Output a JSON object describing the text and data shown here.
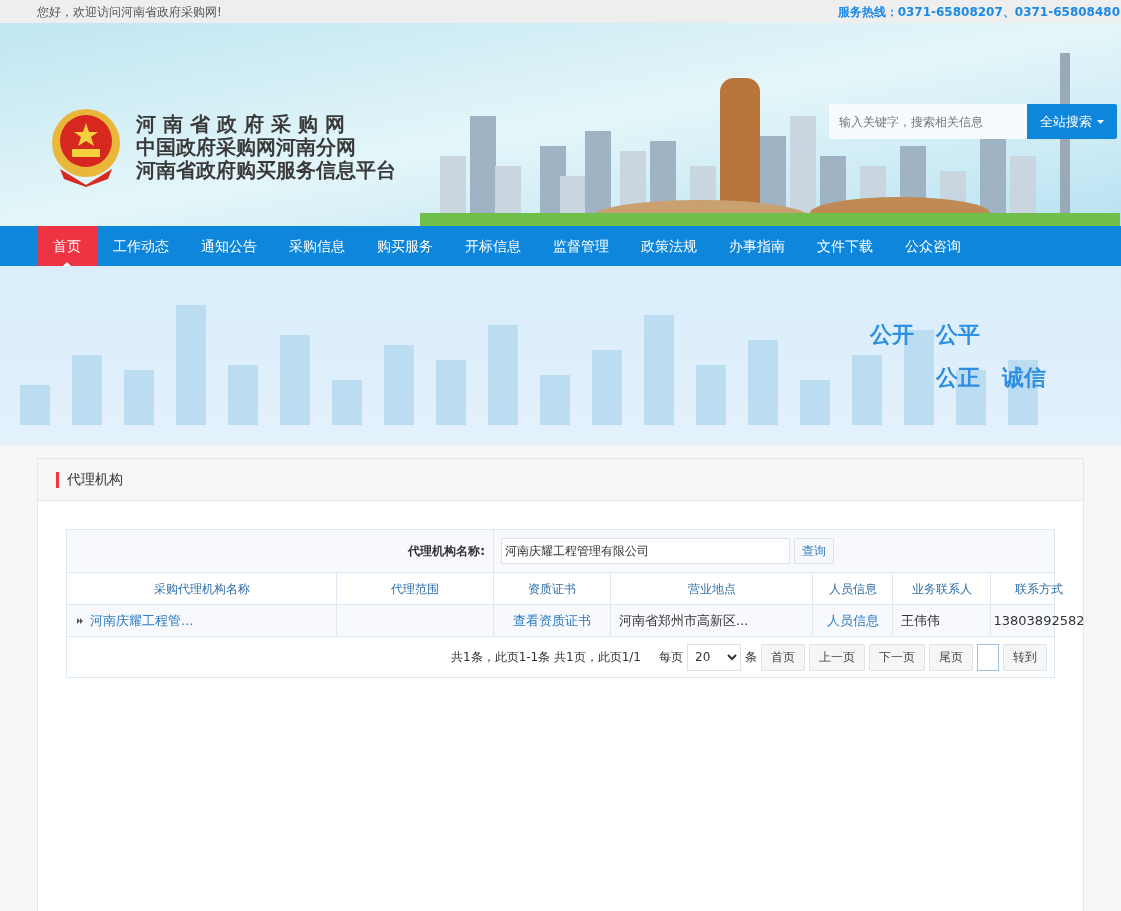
{
  "top_bar": {
    "greeting": "您好，欢迎访问河南省政府采购网!",
    "hotline": "服务热线：0371-65808207、0371-65808480"
  },
  "header": {
    "title_lines": [
      "河 南 省 政 府 采 购 网",
      "中国政府采购网河南分网",
      "河南省政府购买服务信息平台"
    ],
    "search": {
      "placeholder": "输入关键字，搜索相关信息",
      "button": "全站搜索"
    }
  },
  "nav": [
    {
      "label": "首页",
      "selected": true
    },
    {
      "label": "工作动态",
      "selected": false
    },
    {
      "label": "通知公告",
      "selected": false
    },
    {
      "label": "采购信息",
      "selected": false
    },
    {
      "label": "购买服务",
      "selected": false
    },
    {
      "label": "开标信息",
      "selected": false
    },
    {
      "label": "监督管理",
      "selected": false
    },
    {
      "label": "政策法规",
      "selected": false
    },
    {
      "label": "办事指南",
      "selected": false
    },
    {
      "label": "文件下载",
      "selected": false
    },
    {
      "label": "公众咨询",
      "selected": false
    }
  ],
  "slogans": [
    [
      "公开",
      "公平"
    ],
    [
      "公正",
      "诚信"
    ]
  ],
  "panel": {
    "title": "代理机构",
    "filter": {
      "label": "代理机构名称:",
      "value": "河南庆耀工程管理有限公司",
      "button": "查询"
    },
    "table": {
      "columns": [
        "采购代理机构名称",
        "代理范围",
        "资质证书",
        "营业地点",
        "人员信息",
        "业务联系人",
        "联系方式"
      ],
      "rows": [
        {
          "cells": [
            {
              "kind": "link",
              "text": "河南庆耀工程管..."
            },
            {
              "kind": "empty"
            },
            {
              "kind": "link",
              "text": "查看资质证书"
            },
            {
              "kind": "text",
              "text": "河南省郑州市高新区..."
            },
            {
              "kind": "link",
              "text": "人员信息"
            },
            {
              "kind": "text",
              "text": "王伟伟"
            },
            {
              "kind": "text",
              "text": "13803892582"
            }
          ]
        }
      ]
    },
    "pagination": {
      "summary": "共1条，此页1-1条 共1页，此页1/1",
      "per_page_label": "每页",
      "per_page": "20",
      "unit": "条",
      "buttons": [
        "首页",
        "上一页",
        "下一页",
        "尾页"
      ],
      "goto": "转到"
    }
  }
}
